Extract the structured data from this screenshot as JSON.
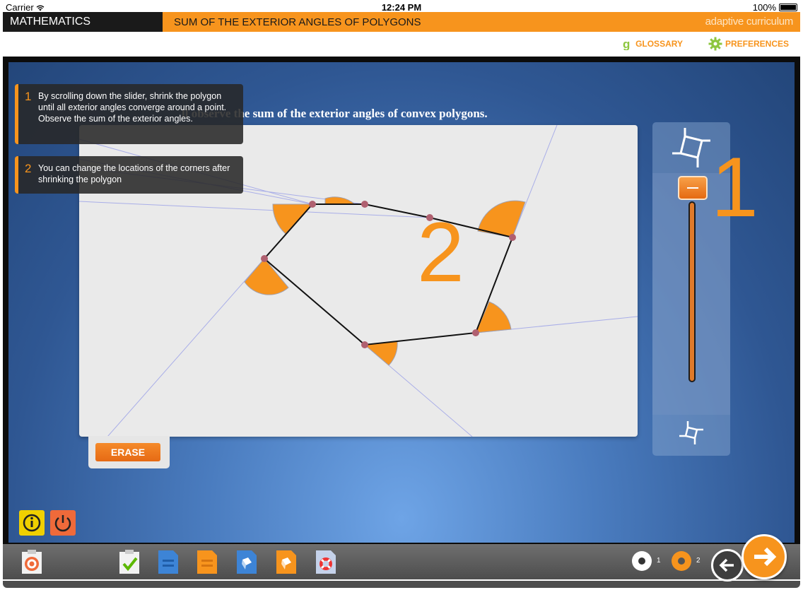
{
  "status": {
    "carrier": "Carrier",
    "time": "12:24 PM",
    "battery": "100%"
  },
  "header": {
    "subject": "MATHEMATICS",
    "lesson": "SUM OF THE EXTERIOR ANGLES OF POLYGONS",
    "brand": "adaptive curriculum"
  },
  "links": {
    "glossary": "GLOSSARY",
    "preferences": "PREFERENCES"
  },
  "activity": {
    "instruction": "ll observe the sum of the exterior angles of convex polygons.",
    "canvas_number": "2",
    "slider_number": "1",
    "slider_level": 0.0,
    "erase_label": "ERASE"
  },
  "tips": [
    {
      "num": "1",
      "text": "By scrolling down the slider, shrink the polygon until all exterior angles converge around a point. Observe the sum of the exterior angles."
    },
    {
      "num": "2",
      "text": "You can change the locations of the corners after shrinking the polygon"
    }
  ],
  "pager": {
    "page1": "1",
    "page2": "2"
  },
  "colors": {
    "accent": "#f7941d",
    "dark": "#1a1a1a",
    "stage": "#3a67a8",
    "vertex": "#b06070"
  }
}
